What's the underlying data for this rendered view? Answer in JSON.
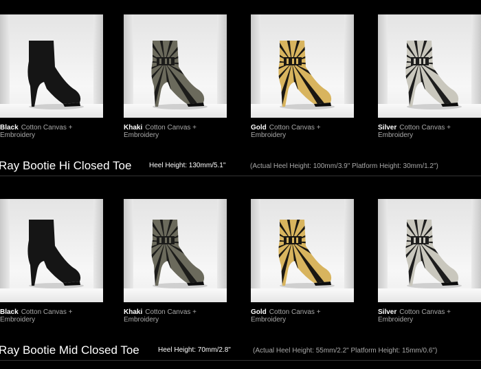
{
  "products": [
    {
      "name": "Ray Bootie Hi Closed Toe",
      "heel_height": "Heel Height: 130mm/5.1\"",
      "actual": "(Actual Heel Height: 100mm/3.9\" Platform Height: 30mm/1.2\")",
      "variants": [
        {
          "color": "Black",
          "material_line1": "Cotton Canvas +",
          "material_line2": "Embroidery",
          "boot_color": "#151515",
          "stripe_color": "#151515"
        },
        {
          "color": "Khaki",
          "material_line1": "Cotton Canvas +",
          "material_line2": "Embroidery",
          "boot_color": "#6b6a5c",
          "stripe_color": "#1c1c1a"
        },
        {
          "color": "Gold",
          "material_line1": "Cotton Canvas +",
          "material_line2": "Embroidery",
          "boot_color": "#d8b45e",
          "stripe_color": "#1a1712"
        },
        {
          "color": "Silver",
          "material_line1": "Cotton Canvas +",
          "material_line2": "Embroidery",
          "boot_color": "#c9c7bd",
          "stripe_color": "#1d1d1d"
        }
      ]
    },
    {
      "name": "Ray Bootie Mid Closed Toe",
      "heel_height": "Heel Height: 70mm/2.8\"",
      "actual": "(Actual Heel Height: 55mm/2.2\" Platform Height: 15mm/0.6\")",
      "variants": [
        {
          "color": "Black",
          "material_line1": "Cotton Canvas +",
          "material_line2": "Embroidery",
          "boot_color": "#151515",
          "stripe_color": "#151515"
        },
        {
          "color": "Khaki",
          "material_line1": "Cotton Canvas +",
          "material_line2": "Embroidery",
          "boot_color": "#6b6a5c",
          "stripe_color": "#1c1c1a"
        },
        {
          "color": "Gold",
          "material_line1": "Cotton Canvas +",
          "material_line2": "Embroidery",
          "boot_color": "#d8b45e",
          "stripe_color": "#1a1712"
        },
        {
          "color": "Silver",
          "material_line1": "Cotton Canvas +",
          "material_line2": "Embroidery",
          "boot_color": "#c9c7bd",
          "stripe_color": "#1d1d1d"
        }
      ]
    }
  ]
}
